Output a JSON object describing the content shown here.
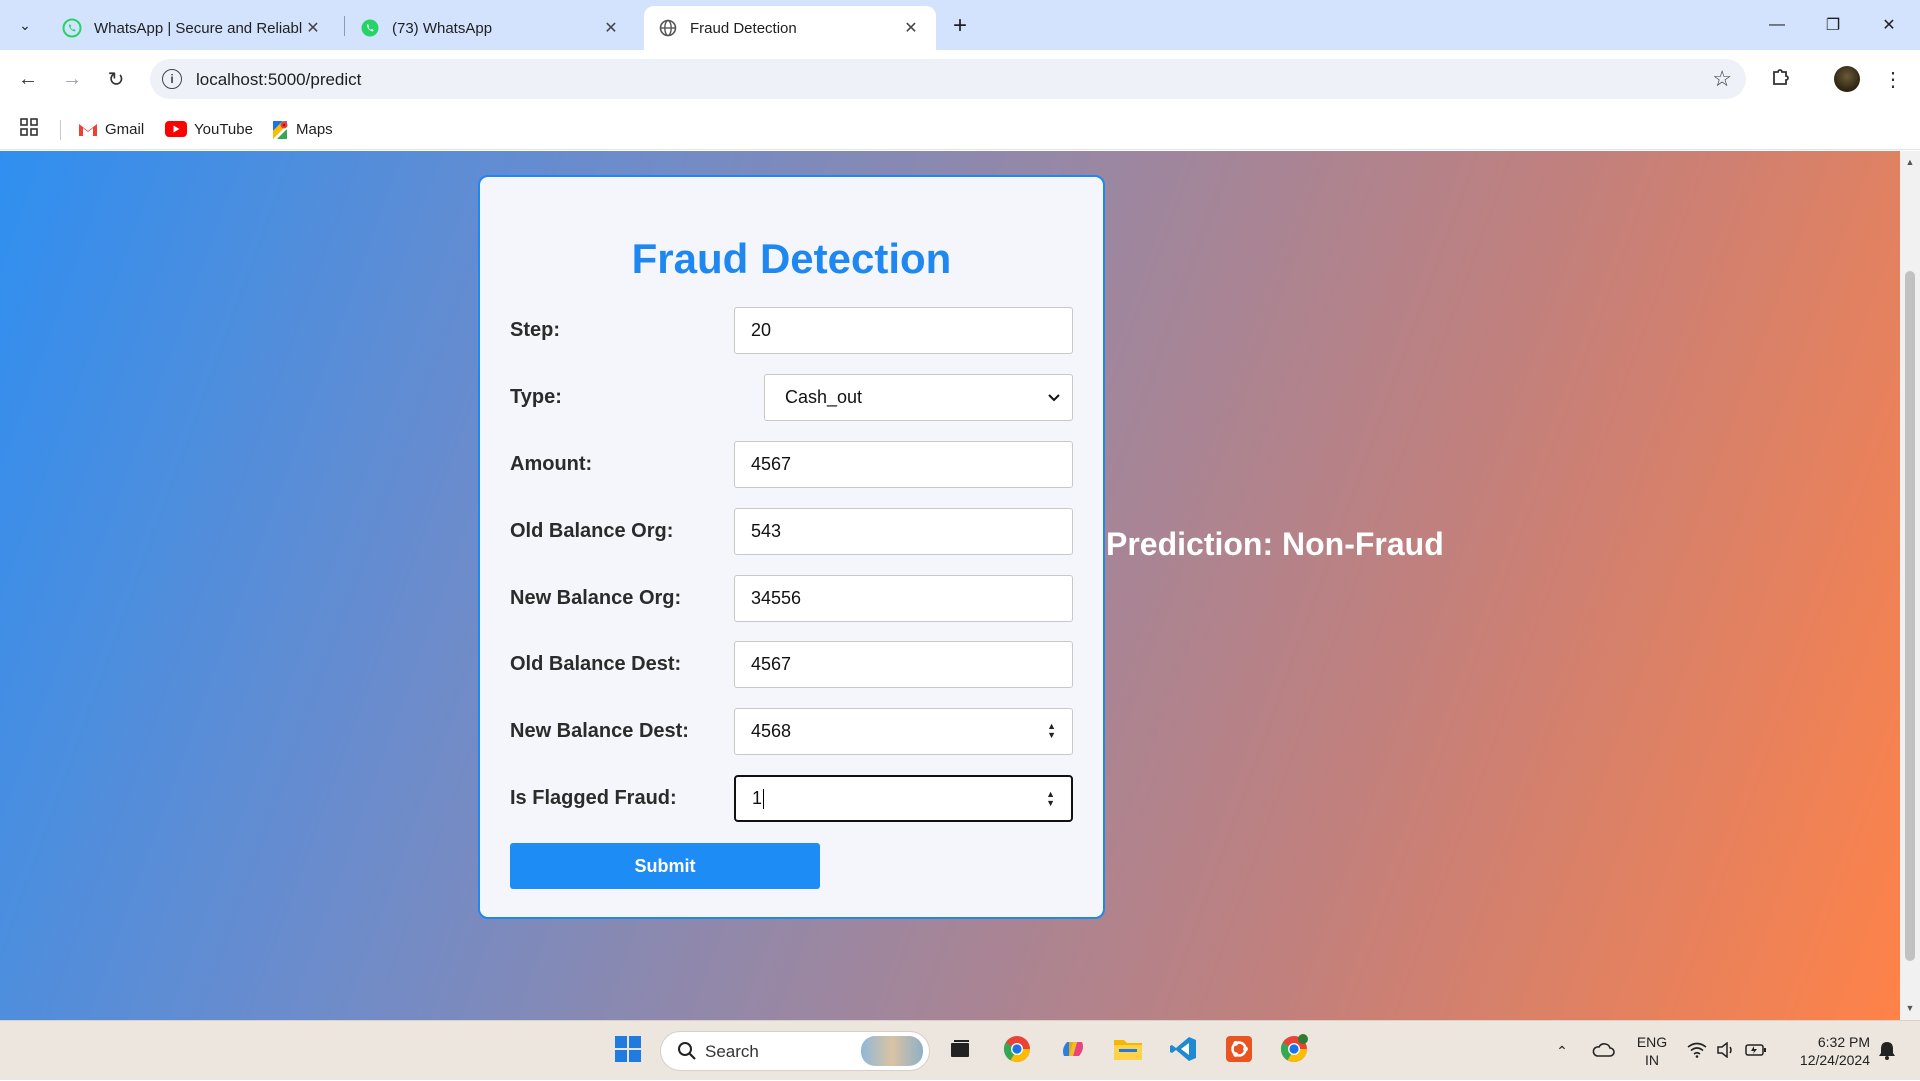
{
  "browser": {
    "tabs": [
      {
        "title": "WhatsApp | Secure and Reliable",
        "active": false
      },
      {
        "title": "(73) WhatsApp",
        "active": false
      },
      {
        "title": "Fraud Detection",
        "active": true
      }
    ],
    "url": "localhost:5000/predict",
    "bookmarks": [
      {
        "label": "Gmail"
      },
      {
        "label": "YouTube"
      },
      {
        "label": "Maps"
      }
    ]
  },
  "form": {
    "title": "Fraud Detection",
    "fields": [
      {
        "label": "Step:",
        "value": "20"
      },
      {
        "label": "Type:",
        "value": "Cash_out"
      },
      {
        "label": "Amount:",
        "value": "4567"
      },
      {
        "label": "Old Balance Org:",
        "value": "543"
      },
      {
        "label": "New Balance Org:",
        "value": "34556"
      },
      {
        "label": "Old Balance Dest:",
        "value": "4567"
      },
      {
        "label": "New Balance Dest:",
        "value": "4568"
      },
      {
        "label": "Is Flagged Fraud:",
        "value": "1"
      }
    ],
    "submit_label": "Submit"
  },
  "prediction_text": "Prediction: Non-Fraud",
  "taskbar": {
    "search_placeholder": "Search",
    "lang_line1": "ENG",
    "lang_line2": "IN",
    "time": "6:32 PM",
    "date": "12/24/2024"
  },
  "colors": {
    "accent": "#1e88f0",
    "gradient_start": "#2f8ff0",
    "gradient_end": "#ff8248"
  }
}
